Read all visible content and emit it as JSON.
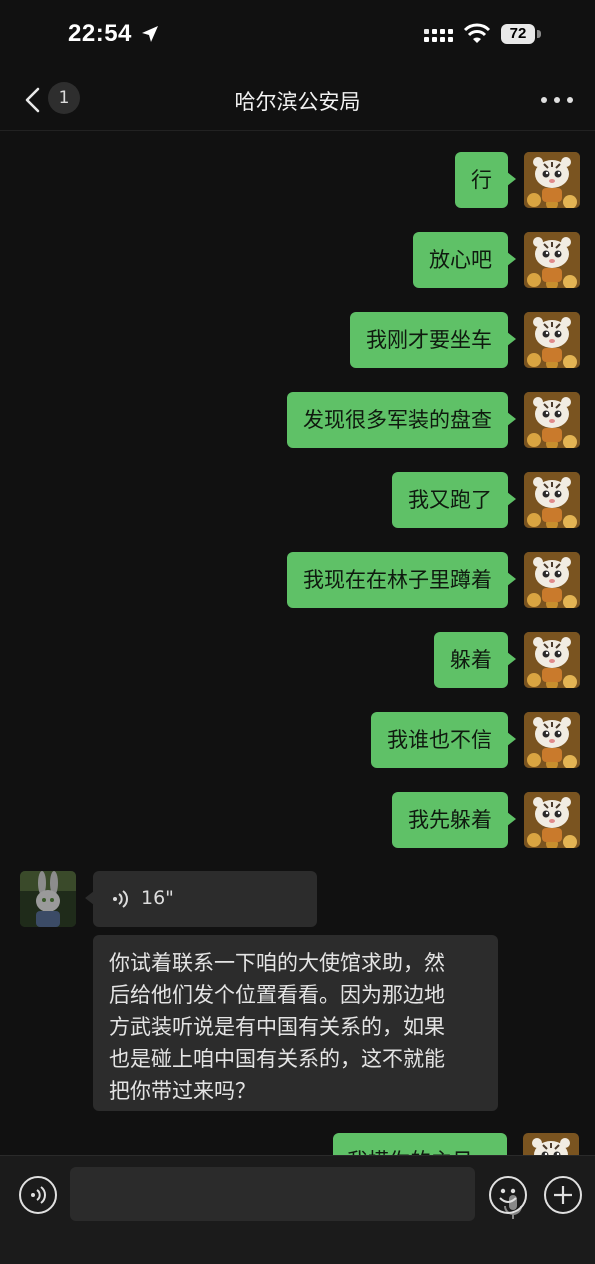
{
  "status_bar": {
    "time": "22:54",
    "battery": "72"
  },
  "nav": {
    "title": "哈尔滨公安局",
    "unread_count": "1"
  },
  "messages_out": [
    {
      "text": "行"
    },
    {
      "text": "放心吧"
    },
    {
      "text": "我刚才要坐车"
    },
    {
      "text": "发现很多军装的盘查"
    },
    {
      "text": "我又跑了"
    },
    {
      "text": "我现在在林子里蹲着"
    },
    {
      "text": "躲着"
    },
    {
      "text": "我谁也不信"
    },
    {
      "text": "我先躲着"
    }
  ],
  "incoming": {
    "voice_duration": "16\"",
    "text_lines": [
      "你试着联系一下咱的大使馆求助，然",
      "后给他们发个位置看看。因为那边地",
      "方武装听说是有中国有关系的，如果",
      "也是碰上咱中国有关系的，这不就能",
      "把你带过来吗？"
    ]
  },
  "partial_outgoing": {
    "text": "我模你的主见"
  },
  "colors": {
    "outgoing_bubble": "#5fc167",
    "incoming_bubble": "#2c2c2c",
    "background": "#111111"
  },
  "icons": [
    "back-chevron-icon",
    "more-icon",
    "voice-mode-icon",
    "mic-icon",
    "emoji-icon",
    "plus-icon"
  ]
}
